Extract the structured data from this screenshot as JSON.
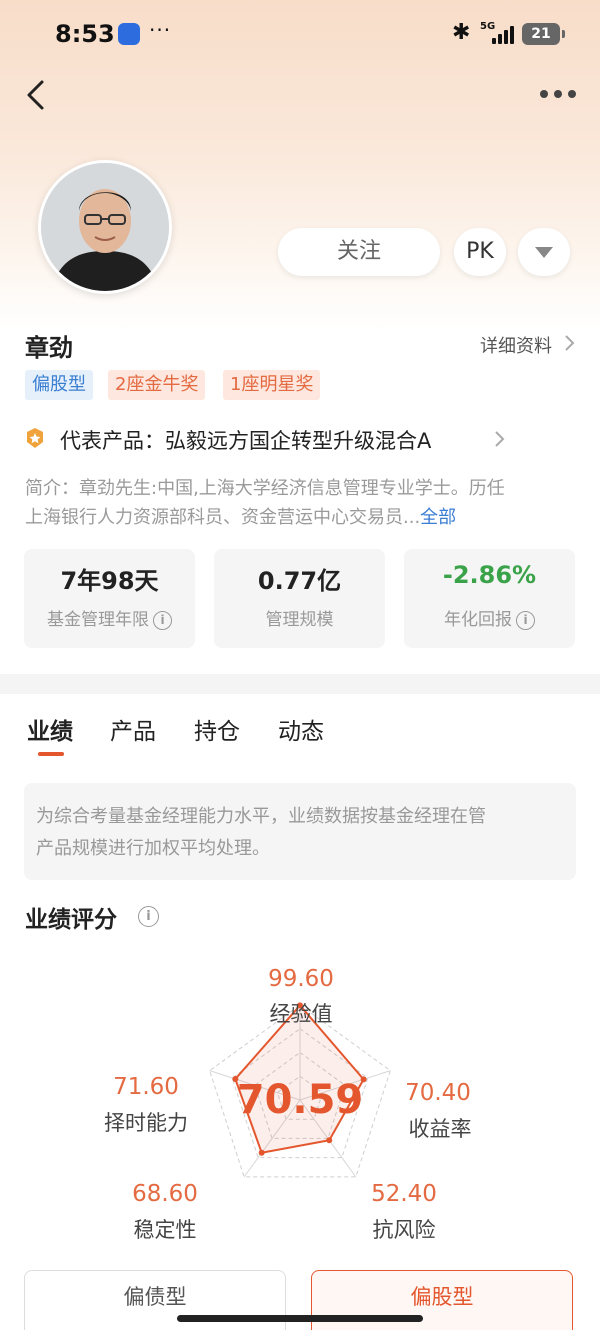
{
  "status_bar": {
    "time": "8:53",
    "dots": "···",
    "network": "5G",
    "battery": "21",
    "app_icon": "baidu-map-icon"
  },
  "header": {
    "back_icon": "chevron-left-icon",
    "more_icon": "more-horizontal-icon"
  },
  "profile": {
    "avatar": "manager-avatar-photo",
    "follow_label": "关注",
    "pk_label": "PK",
    "dropdown_icon": "triangle-down-icon",
    "name": "章劲",
    "detail_link": "详细资料",
    "tags": [
      "偏股型",
      "2座金牛奖",
      "1座明星奖"
    ],
    "product_prefix": "代表产品：",
    "product_name": "弘毅远方国企转型升级混合A",
    "intro_line1": "简介：章劲先生:中国,上海大学经济信息管理专业学士。历任",
    "intro_line2": "上海银行人力资源部科员、资金营运中心交易员...",
    "intro_more": "全部"
  },
  "stats": [
    {
      "value": "7年98天",
      "label": "基金管理年限",
      "info": true,
      "color": "#222222"
    },
    {
      "value": "0.77亿",
      "label": "管理规模",
      "info": false,
      "color": "#222222"
    },
    {
      "value": "-2.86%",
      "label": "年化回报",
      "info": true,
      "color": "#3aa34a"
    }
  ],
  "tabs": [
    {
      "label": "业绩",
      "active": true
    },
    {
      "label": "产品",
      "active": false
    },
    {
      "label": "持仓",
      "active": false
    },
    {
      "label": "动态",
      "active": false
    }
  ],
  "notice": {
    "line1": "为综合考量基金经理能力水平，业绩数据按基金经理在管",
    "line2": "产品规模进行加权平均处理。"
  },
  "score_section": {
    "title": "业绩评分",
    "overall": "70.59",
    "dimensions": [
      {
        "label": "经验值",
        "value": 99.6,
        "display": "99.60"
      },
      {
        "label": "收益率",
        "value": 70.4,
        "display": "70.40"
      },
      {
        "label": "抗风险",
        "value": 52.4,
        "display": "52.40"
      },
      {
        "label": "稳定性",
        "value": 68.6,
        "display": "68.60"
      },
      {
        "label": "择时能力",
        "value": 71.6,
        "display": "71.60"
      }
    ],
    "max": 100,
    "accent": "#e4572e"
  },
  "style_tabs": [
    {
      "label": "偏债型",
      "active": false
    },
    {
      "label": "偏股型",
      "active": true
    }
  ]
}
